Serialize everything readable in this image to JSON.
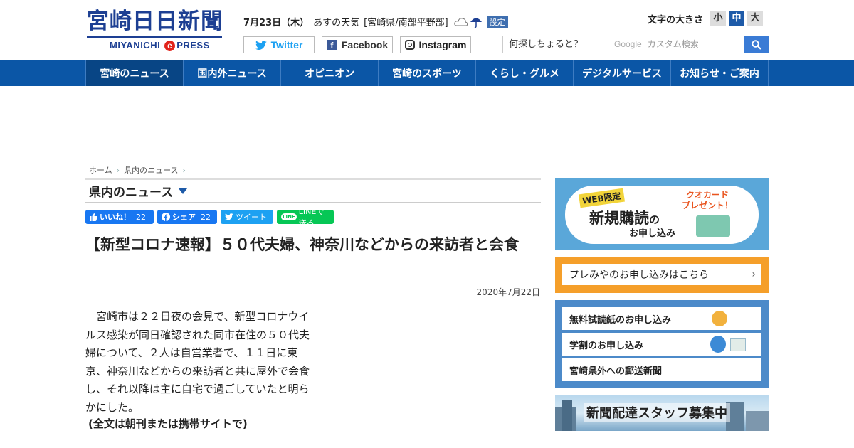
{
  "header": {
    "logo_title": "宮崎日日新聞",
    "logo_sub_left": "MIYANICHI",
    "logo_sub_e": "e",
    "logo_sub_right": "PRESS",
    "date": "7月23日（木）",
    "weather_label": "あすの天気",
    "weather_region": "[宮崎県/南部平野部]",
    "weather_setting": "設定",
    "fontsize_label": "文字の大きさ",
    "fontsize_small": "小",
    "fontsize_medium": "中",
    "fontsize_large": "大",
    "social": {
      "twitter": "Twitter",
      "facebook": "Facebook",
      "instagram": "Instagram"
    },
    "search_prompt": "何探しちょると？",
    "search_google": "Google",
    "search_placeholder": "カスタム検索"
  },
  "nav": {
    "items": [
      "宮崎のニュース",
      "国内外ニュース",
      "オピニオン",
      "宮崎のスポーツ",
      "くらし・グルメ",
      "デジタルサービス",
      "お知らせ・ご案内"
    ]
  },
  "breadcrumb": {
    "home": "ホーム",
    "section": "県内のニュース"
  },
  "section_title": "県内のニュース",
  "share": {
    "like_label": "いいね！",
    "like_count": "22",
    "fb_label": "シェア",
    "fb_count": "22",
    "tweet_label": "ツイート",
    "line_icon": "LINE",
    "line_label": "LINEで送る"
  },
  "article": {
    "headline": "【新型コロナ速報】５０代夫婦、神奈川などからの来訪者と会食",
    "date": "2020年7月22日",
    "body": "　宮崎市は２２日夜の会見で、新型コロナウイルス感染が同日確認された同市在住の５０代夫婦について、２人は自営業者で、１１日に東京、神奈川などからの来訪者と共に屋外で会食し、それ以降は主に自宅で過ごしていたと明らかにした。",
    "note": "(全文は朝刊または携帯サイトで)"
  },
  "sidebar": {
    "banner1_tag": "WEB限定",
    "banner1_main": "新規購読",
    "banner1_no": "の",
    "banner1_sub": "お申し込み",
    "banner1_quo_l1": "クオカード",
    "banner1_quo_l2": "プレゼント！",
    "banner2": "プレみやのお申し込みはこちら",
    "links": [
      "無料試読紙のお申し込み",
      "学割のお申し込み",
      "宮崎県外への郵送新聞"
    ],
    "recruit": "新聞配達スタッフ募集中"
  }
}
